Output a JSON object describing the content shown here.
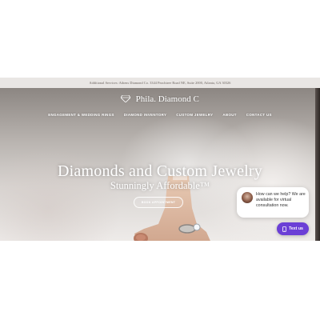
{
  "topbar": {
    "address": "Additional Services: Athens Diamond Co. 3344 Peachtree Road NE, Suite 2000, Atlanta, GA 30326"
  },
  "brand": {
    "name": "Phila. Diamond C",
    "logo_icon": "diamond-icon"
  },
  "nav": {
    "items": [
      {
        "label": "ENGAGEMENT & WEDDING RINGS"
      },
      {
        "label": "DIAMOND INVENTORY"
      },
      {
        "label": "CUSTOM JEWELRY"
      },
      {
        "label": "ABOUT"
      },
      {
        "label": "CONTACT US"
      }
    ]
  },
  "hero": {
    "headline": "Diamonds and Custom Jewelry",
    "subheadline": "Stunningly Affordable™",
    "cta_label": "BOOK APPOINTMENT"
  },
  "chat": {
    "message": "How can we help? We are available for virtual consultation now.",
    "button_label": "Text us",
    "button_icon": "phone-icon",
    "accent": "#6b3fd6"
  },
  "colors": {
    "topbar_bg": "#e9e6e4",
    "hero_text": "#ffffff"
  }
}
